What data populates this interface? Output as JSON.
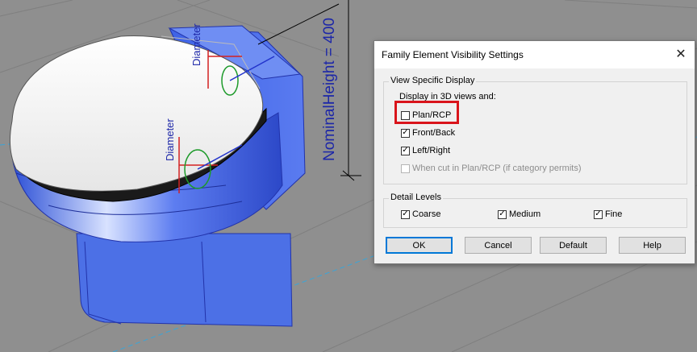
{
  "viewport": {
    "dimension_label": "NominalHeight = 400",
    "diameter_label_1": "Diameter",
    "diameter_label_2": "Diameter"
  },
  "dialog": {
    "title": "Family Element Visibility Settings",
    "close_glyph": "✕",
    "view_specific": {
      "legend": "View Specific Display",
      "sub_label": "Display in 3D views and:",
      "options": [
        {
          "label": "Plan/RCP",
          "checked": false
        },
        {
          "label": "Front/Back",
          "checked": true
        },
        {
          "label": "Left/Right",
          "checked": true
        },
        {
          "label": "When cut in Plan/RCP (if category permits)",
          "checked": false,
          "disabled": true
        }
      ]
    },
    "detail_levels": {
      "legend": "Detail Levels",
      "options": [
        {
          "label": "Coarse",
          "checked": true
        },
        {
          "label": "Medium",
          "checked": true
        },
        {
          "label": "Fine",
          "checked": true
        }
      ]
    },
    "buttons": {
      "ok": "OK",
      "cancel": "Cancel",
      "default": "Default",
      "help": "Help"
    }
  },
  "colors": {
    "viewport_bg": "#8f8f8f",
    "model_blue": "#4a6fe0",
    "highlight_red": "#d9141b",
    "dimension_blue": "#1d27a8"
  }
}
